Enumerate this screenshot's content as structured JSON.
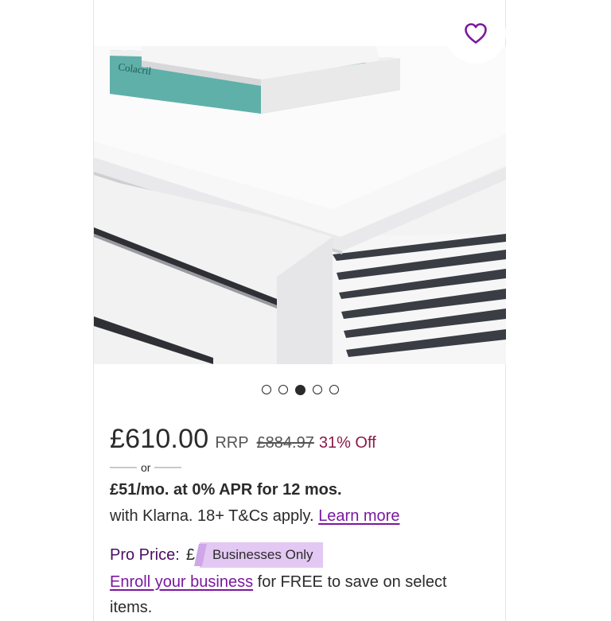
{
  "product": {
    "image_alt": "White high gloss coffee table",
    "carousel": {
      "total": 5,
      "active_index": 2
    }
  },
  "pricing": {
    "price": "£610.00",
    "rrp_label": "RRP",
    "was_price": "£884.97",
    "discount": "31% Off",
    "or_text": "or"
  },
  "klarna": {
    "headline": "£51/mo. at 0% APR for 12 mos.",
    "subtext": "with Klarna. 18+ T&Cs apply.",
    "learn_more": "Learn more"
  },
  "pro": {
    "label": "Pro Price:",
    "currency": "£",
    "badge": "Businesses Only",
    "enroll_link": "Enroll your business",
    "enroll_text": " for FREE to save on select items."
  },
  "icons": {
    "favorite": "heart-icon"
  },
  "colors": {
    "accent": "#7b189f",
    "discount": "#8b1a47",
    "badge": "#e3c8f3"
  }
}
